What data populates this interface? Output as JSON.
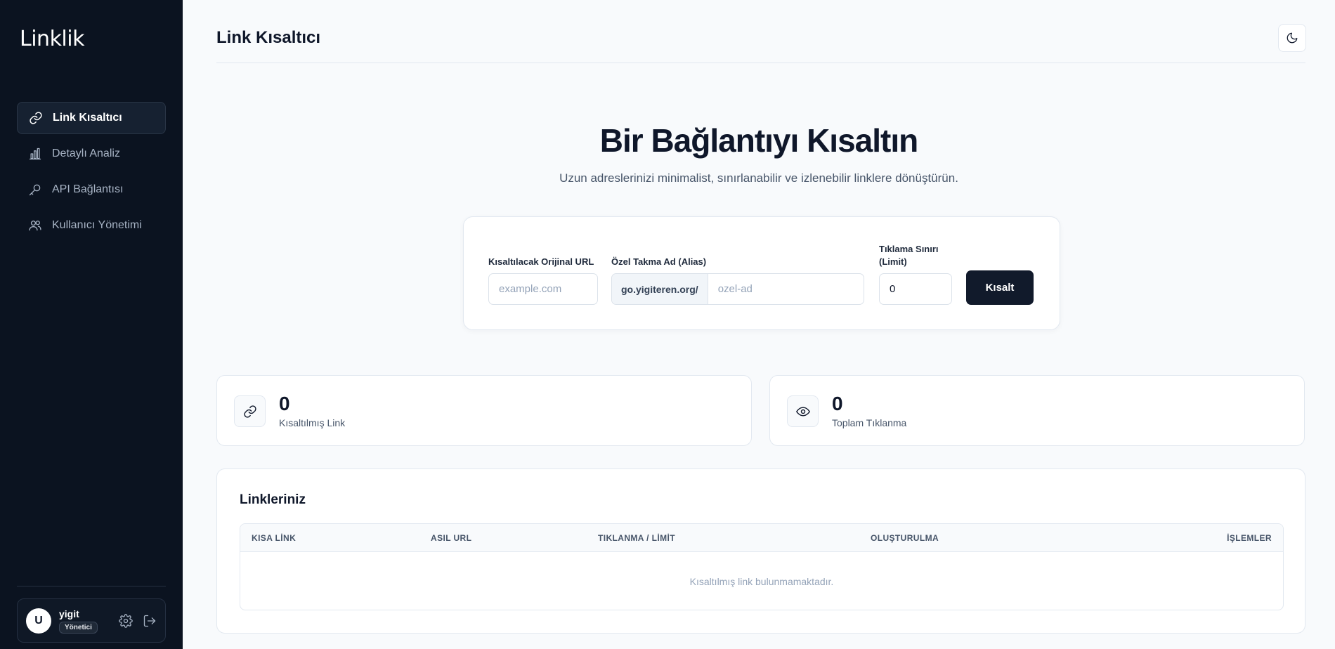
{
  "sidebar": {
    "logo": "Linklik",
    "items": [
      {
        "label": "Link Kısaltıcı",
        "icon": "link-icon",
        "active": true
      },
      {
        "label": "Detaylı Analiz",
        "icon": "bar-chart-icon",
        "active": false
      },
      {
        "label": "API Bağlantısı",
        "icon": "key-icon",
        "active": false
      },
      {
        "label": "Kullanıcı Yönetimi",
        "icon": "users-icon",
        "active": false
      }
    ],
    "user": {
      "initial": "U",
      "name": "yigit",
      "role": "Yönetici"
    }
  },
  "header": {
    "title": "Link Kısaltıcı",
    "theme_toggle_icon": "moon-icon"
  },
  "hero": {
    "title": "Bir Bağlantıyı Kısaltın",
    "subtitle": "Uzun adreslerinizi minimalist, sınırlanabilir ve izlenebilir linklere dönüştürün."
  },
  "form": {
    "url_label": "Kısaltılacak Orijinal URL",
    "url_placeholder": "example.com",
    "alias_label": "Özel Takma Ad (Alias)",
    "alias_prefix": "go.yigiteren.org/",
    "alias_placeholder": "ozel-ad",
    "limit_label_line1": "Tıklama Sınırı",
    "limit_label_line2": "(Limit)",
    "limit_value": "0",
    "submit_label": "Kısalt"
  },
  "stats": [
    {
      "value": "0",
      "label": "Kısaltılmış Link",
      "icon": "link-icon"
    },
    {
      "value": "0",
      "label": "Toplam Tıklanma",
      "icon": "eye-icon"
    }
  ],
  "links_table": {
    "title": "Linkleriniz",
    "columns": [
      "KISA LİNK",
      "ASIL URL",
      "TIKLANMA / LİMİT",
      "OLUŞTURULMA",
      "İŞLEMLER"
    ],
    "empty_message": "Kısaltılmış link bulunmamaktadır."
  },
  "colors": {
    "sidebar_bg": "#0b1320",
    "primary_button": "#111a2b",
    "page_bg": "#f8fafc"
  }
}
